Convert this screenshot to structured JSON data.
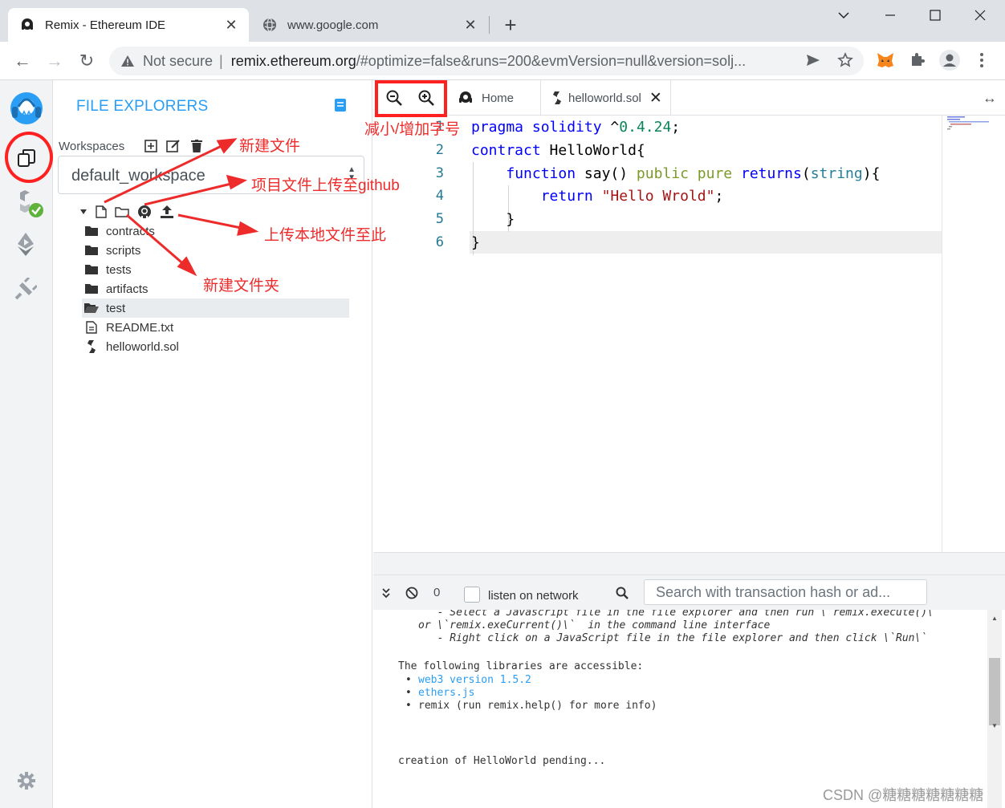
{
  "browser": {
    "tabs": [
      {
        "title": "Remix - Ethereum IDE",
        "active": true
      },
      {
        "title": "www.google.com",
        "active": false
      }
    ],
    "new_tab_label": "+",
    "window_controls": {
      "minimize": "—",
      "maximize": "☐",
      "close": "✕"
    },
    "nav": {
      "back": "←",
      "forward": "→",
      "reload": "↻"
    },
    "omnibox": {
      "security_text": "Not secure",
      "separator": "|",
      "host": "remix.ethereum.org",
      "path": "/#optimize=false&runs=200&evmVersion=null&version=solj..."
    },
    "accent": "#2a9df4"
  },
  "remix": {
    "icon_panel": {
      "items": [
        "remix-logo-icon",
        "file-explorer-icon",
        "solidity-compiler-icon",
        "deploy-run-icon",
        "plugin-manager-icon",
        "settings-icon"
      ]
    },
    "side_panel": {
      "title": "FILE EXPLORERS",
      "workspaces_label": "Workspaces",
      "workspace_selected": "default_workspace",
      "tree": [
        {
          "name": "contracts",
          "type": "folder"
        },
        {
          "name": "scripts",
          "type": "folder"
        },
        {
          "name": "tests",
          "type": "folder"
        },
        {
          "name": "artifacts",
          "type": "folder"
        },
        {
          "name": "test",
          "type": "folder-open",
          "selected": true
        },
        {
          "name": "README.txt",
          "type": "file"
        },
        {
          "name": "helloworld.sol",
          "type": "sol"
        }
      ]
    },
    "editor": {
      "tabs": [
        {
          "label": "Home"
        },
        {
          "label": "helloworld.sol",
          "close": "✕"
        }
      ],
      "expand_label": "↔",
      "line_numbers": [
        "1",
        "2",
        "3",
        "4",
        "5",
        "6"
      ]
    },
    "terminal": {
      "count": "0",
      "listen_label": "listen on network",
      "search_placeholder": "Search with transaction hash or ad...",
      "lines": [
        "  - Select a Javascript file in the file explorer and then run \\`remix.execute()\\`",
        "or \\`remix.exeCurrent()\\`  in the command line interface",
        "  - Right click on a JavaScript file in the file explorer and then click \\`Run\\`",
        "The following libraries are accessible:",
        "web3 version 1.5.2",
        "ethers.js",
        "remix (run remix.help() for more info)",
        "creation of HelloWorld pending..."
      ],
      "bullet": "•"
    }
  },
  "annotations": {
    "zoom": "减小/增加字号",
    "new_file": "新建文件",
    "github": "项目文件上传至github",
    "upload": "上传本地文件至此",
    "new_folder": "新建文件夹",
    "color": "#ee2b2b"
  },
  "watermark": "CSDN @糖糖糖糖糖糖糖"
}
